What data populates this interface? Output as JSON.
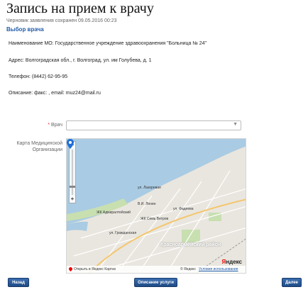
{
  "page": {
    "title": "Запись на прием к врачу",
    "draft_note": "Черновик заявления сохранен 09.05.2016 00:23",
    "section_title": "Выбор врача"
  },
  "info": {
    "org_name": "Наименование МО: Государственное учреждение здравоохранения \"Больница № 24\"",
    "address": "Адрес: Волгоградская обл., г. Волгоград, ул. им Голубева, д. 1",
    "phone": "Телефон: (8442) 62-95-95",
    "description": "Описание: факс: , email: muz24@mail.ru"
  },
  "form": {
    "doctor_label": "Врач",
    "doctor_required_mark": "*",
    "doctor_value": "",
    "map_label_line1": "Карта Медицинской",
    "map_label_line2": "Организации"
  },
  "map": {
    "labels": {
      "vilenin": "В.И. Ленин",
      "admiralteysky": "ЖК Адмиралтейский",
      "sem_vetrov": "ЖК Семь Ветров",
      "district": "Красноармейский район",
      "street_1": "ул. Фадеева",
      "street_2": "ул. Лазоревая",
      "street_3": "ул. Гражданская"
    },
    "open_link": "Открыть в Яндекс Картах",
    "copyright": "© Яндекс",
    "terms": "Условия использования",
    "logo_y": "Я",
    "logo_rest": "ндекс",
    "zoom_in": "+",
    "zoom_out": "−"
  },
  "buttons": {
    "back": "Назад",
    "service_description": "Описание услуги",
    "next": "Далее"
  },
  "colors": {
    "accent": "#1e5aa8",
    "button": "#2a5c9e",
    "map_water": "#a9cbe3",
    "map_land": "#e9e6df"
  }
}
